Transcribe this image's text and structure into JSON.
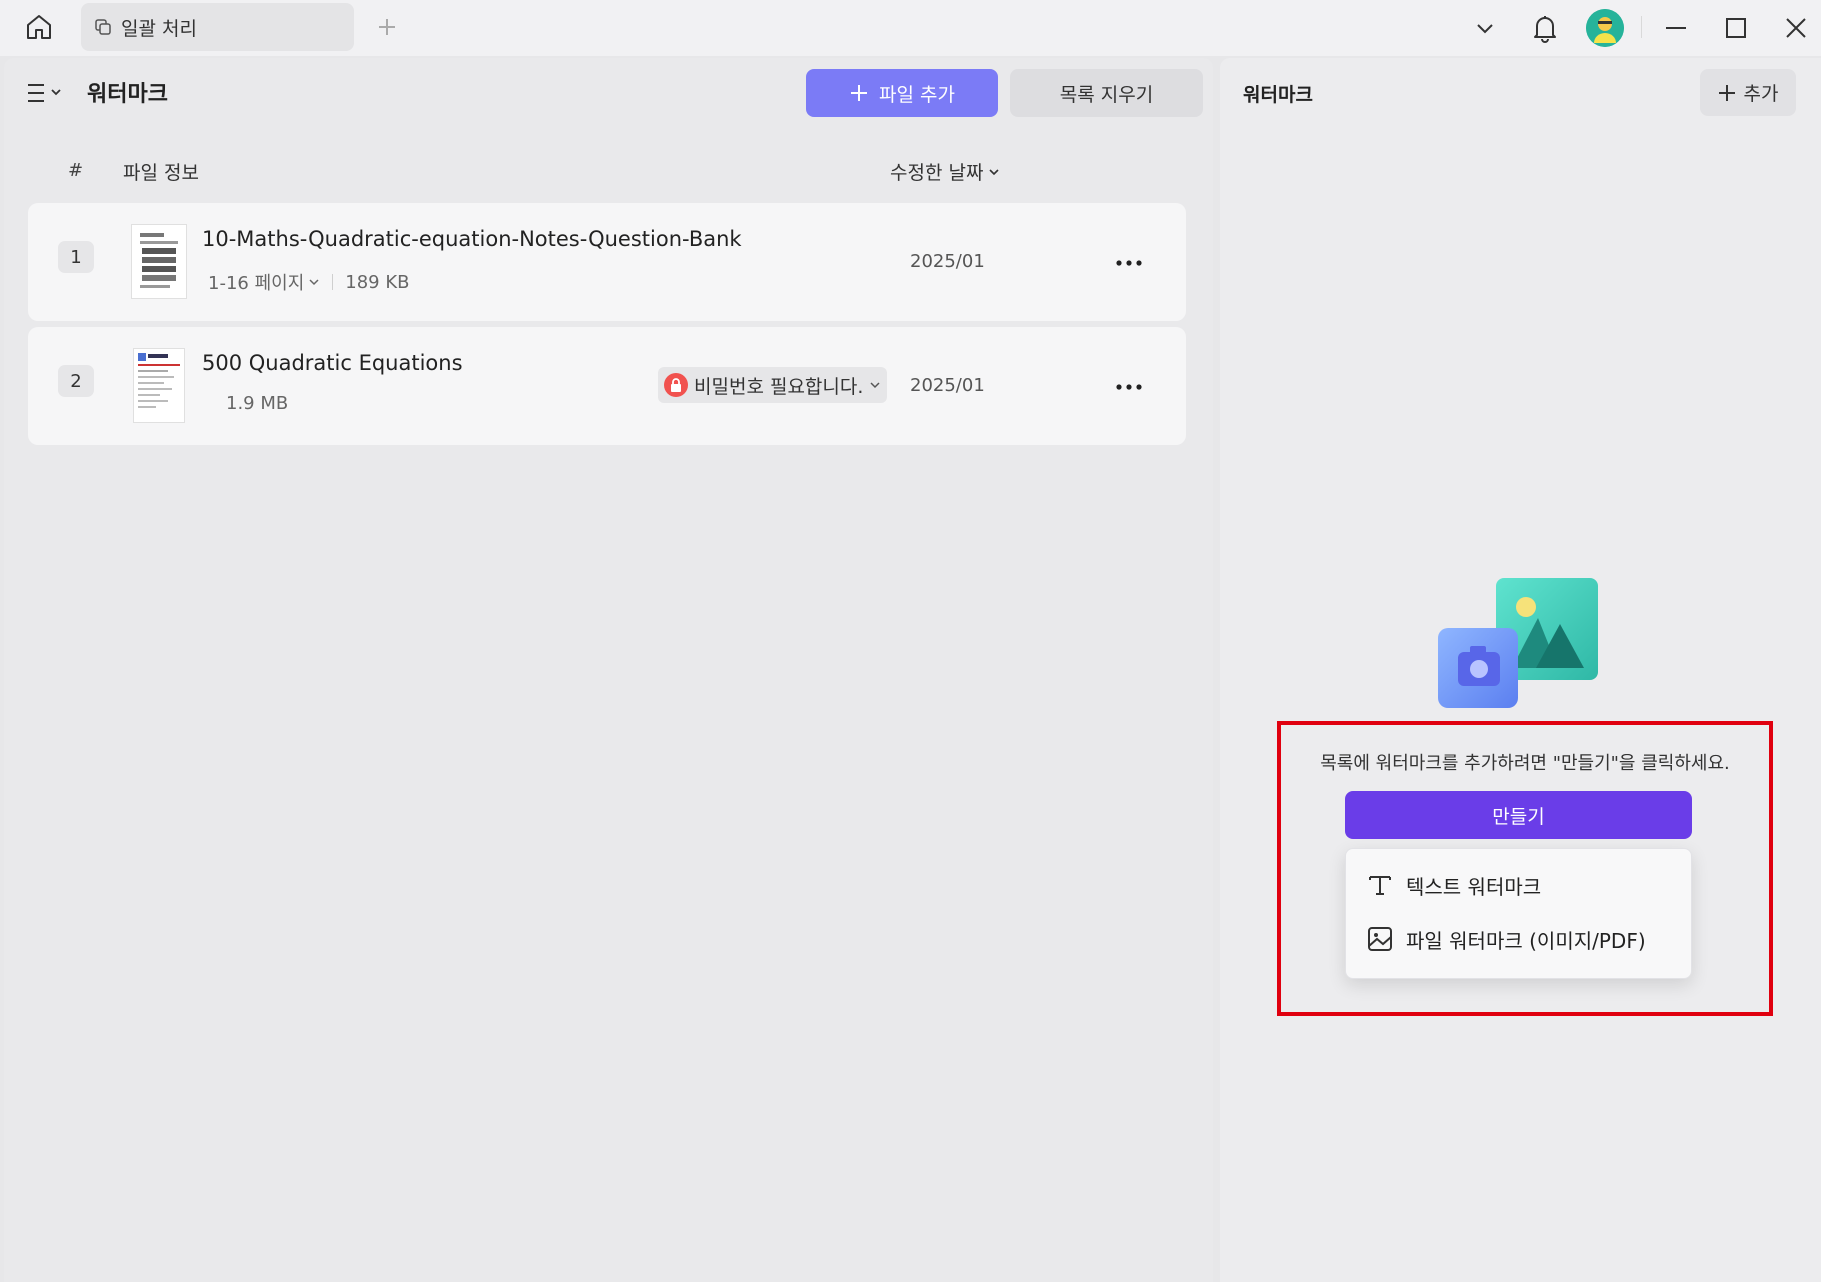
{
  "titlebar": {
    "tab_label": "일괄 처리",
    "icons": [
      "home-icon",
      "copy-icon",
      "plus-icon",
      "chevron-down-icon",
      "bell-icon",
      "avatar",
      "minimize-icon",
      "maximize-icon",
      "close-icon"
    ]
  },
  "left": {
    "title": "워터마크",
    "add_file_label": "파일 추가",
    "clear_list_label": "목록 지우기",
    "columns": {
      "num": "#",
      "info": "파일 정보",
      "date": "수정한 날짜"
    },
    "files": [
      {
        "num": "1",
        "name": "10-Maths-Quadratic-equation-Notes-Question-Bank",
        "pages": "1-16 페이지",
        "size": "189 KB",
        "date": "2025/01"
      },
      {
        "num": "2",
        "name": "500 Quadratic Equations",
        "size": "1.9 MB",
        "badge": "비밀번호 필요합니다.",
        "date": "2025/01"
      }
    ]
  },
  "right": {
    "title": "워터마크",
    "add_label": "추가",
    "hint": "목록에 워터마크를 추가하려면 \"만들기\"을 클릭하세요.",
    "create_label": "만들기",
    "menu": [
      {
        "label": "텍스트 워터마크",
        "icon": "text-icon"
      },
      {
        "label": "파일 워터마크 (이미지/PDF)",
        "icon": "image-file-icon"
      }
    ],
    "colors": {
      "accent": "#6a3de8",
      "add_file": "#7b7bf6",
      "highlight": "#e0000f"
    }
  }
}
